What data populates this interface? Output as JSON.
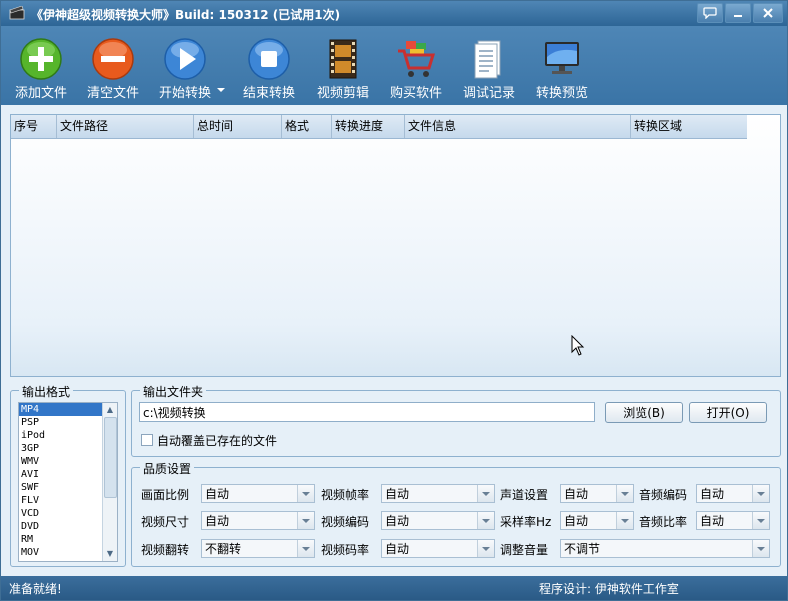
{
  "window": {
    "title": "《伊神超级视频转换大师》Build: 150312 (已试用1次)"
  },
  "toolbar": {
    "items": [
      {
        "label": "添加文件",
        "icon": "add-icon"
      },
      {
        "label": "清空文件",
        "icon": "clear-icon"
      },
      {
        "label": "开始转换",
        "icon": "play-icon"
      },
      {
        "label": "结束转换",
        "icon": "stop-icon"
      },
      {
        "label": "视频剪辑",
        "icon": "film-icon"
      },
      {
        "label": "购买软件",
        "icon": "cart-icon"
      },
      {
        "label": "调试记录",
        "icon": "log-icon"
      },
      {
        "label": "转换预览",
        "icon": "monitor-icon"
      }
    ]
  },
  "filelist": {
    "columns": [
      "序号",
      "文件路径",
      "总时间",
      "格式",
      "转换进度",
      "文件信息",
      "转换区域"
    ]
  },
  "output_format": {
    "legend": "输出格式",
    "items": [
      "MP4",
      "PSP",
      "iPod",
      "3GP",
      "WMV",
      "AVI",
      "SWF",
      "FLV",
      "VCD",
      "DVD",
      "RM",
      "MOV"
    ],
    "selected": "MP4"
  },
  "output_folder": {
    "legend": "输出文件夹",
    "path": "c:\\视频转换",
    "browse_label": "浏览(B)",
    "open_label": "打开(O)",
    "overwrite_label": "自动覆盖已存在的文件"
  },
  "quality": {
    "legend": "品质设置",
    "aspect_label": "画面比例",
    "aspect_value": "自动",
    "fps_label": "视频帧率",
    "fps_value": "自动",
    "channel_label": "声道设置",
    "channel_value": "自动",
    "acodec_label": "音频编码",
    "acodec_value": "自动",
    "size_label": "视频尺寸",
    "size_value": "自动",
    "vcodec_label": "视频编码",
    "vcodec_value": "自动",
    "samplerate_label": "采样率Hz",
    "samplerate_value": "自动",
    "abitrate_label": "音频比率",
    "abitrate_value": "自动",
    "flip_label": "视频翻转",
    "flip_value": "不翻转",
    "vbitrate_label": "视频码率",
    "vbitrate_value": "自动",
    "volume_label": "调整音量",
    "volume_value": "不调节"
  },
  "status": {
    "left": "准备就绪!",
    "right": "程序设计: 伊神软件工作室"
  }
}
